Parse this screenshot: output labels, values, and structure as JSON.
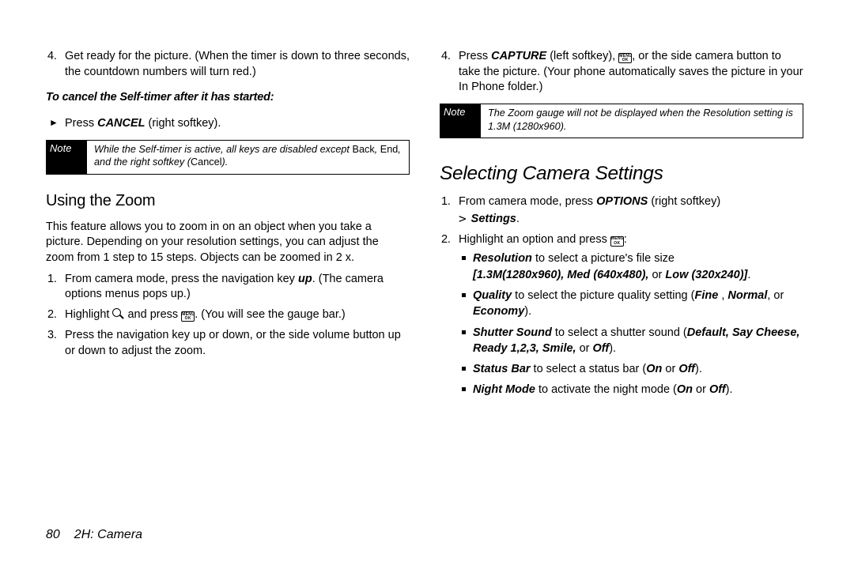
{
  "left": {
    "item4_num": "4.",
    "item4_pre": "Get ready for the picture. (When the timer is down to three seconds, the countdown numbers will turn red.)",
    "cancel_head": "To cancel the Self-timer after it has started:",
    "cancel_pre": "Press",
    "cancel_bold": " CANCEL",
    "cancel_post": " (right softkey).",
    "note_label": "Note",
    "note1_pre": "While the Self-timer is active, all keys are disabled except ",
    "note1_back": "Back",
    "note1_comma": ", ",
    "note1_end": "End",
    "note1_mid": ", and the right softkey (",
    "note1_cancel": "Cancel",
    "note1_post": ").",
    "zoom_head": "Using the Zoom",
    "zoom_para": "This feature allows you to zoom in on an object when you take a picture. Depending on your resolution settings, you can adjust the zoom from 1 step to 15 steps. Objects can be zoomed in 2 x.",
    "z1_num": "1.",
    "z1_pre": "From camera mode, press the navigation key ",
    "z1_up": "up",
    "z1_post": ". (The camera options menus pops up.)",
    "z2_num": "2.",
    "z2_pre": "Highlight ",
    "z2_mid": " and press ",
    "z2_key": "MENU\nOK",
    "z2_post": ". (You will see the gauge bar.)",
    "z3_num": "3.",
    "z3_text": "Press the navigation key up or down, or the side volume button up or down to adjust the zoom."
  },
  "right": {
    "item4_num": "4.",
    "r4_pre": "Press ",
    "r4_cap": "CAPTURE",
    "r4_mid1": " (left softkey), ",
    "r4_key": "MENU\nOK",
    "r4_post": ", or the side camera button to take the picture. (Your phone automatically saves the picture in your In Phone folder.)",
    "note_label": "Note",
    "note2_text": "The Zoom gauge will not be displayed when the Resolution setting is 1.3M (1280x960).",
    "scs_head": "Selecting Camera Settings",
    "s1_num": "1.",
    "s1_pre": "From camera mode, press ",
    "s1_opt": "OPTIONS",
    "s1_mid": " (right softkey) ",
    "s1_gt": ">",
    "s1_set": " Settings",
    "s1_post": ".",
    "s2_num": "2.",
    "s2_pre": "Highlight an option and press ",
    "s2_key": "MENU\nOK",
    "s2_post": ":",
    "b1_name": "Resolution",
    "b1_mid": " to select a picture's file size ",
    "b1_opts": "[1.3M(1280x960), Med (640x480),",
    "b1_or": " or ",
    "b1_low": "Low (320x240)]",
    "b1_post": ".",
    "b2_name": "Quality",
    "b2_mid": " to select the picture quality setting (",
    "b2_fine": "Fine ",
    "b2_c": ", ",
    "b2_norm": "Normal",
    "b2_or": ", or ",
    "b2_eco": "Economy",
    "b2_post": ").",
    "b3_name": "Shutter Sound",
    "b3_mid": " to select a shutter sound (",
    "b3_opts": "Default, Say Cheese, Ready 1,2,3, Smile,",
    "b3_or": " or ",
    "b3_off": "Off",
    "b3_post": ").",
    "b4_name": "Status Bar",
    "b4_mid": " to select a status bar (",
    "b4_on": "On",
    "b4_or": " or ",
    "b4_off": "Off",
    "b4_post": ").",
    "b5_name": "Night Mode",
    "b5_mid": " to activate the night mode (",
    "b5_on": "On",
    "b5_or": " or ",
    "b5_off": "Off",
    "b5_post": ")."
  },
  "footer": {
    "page": "80",
    "section": "2H: Camera"
  }
}
